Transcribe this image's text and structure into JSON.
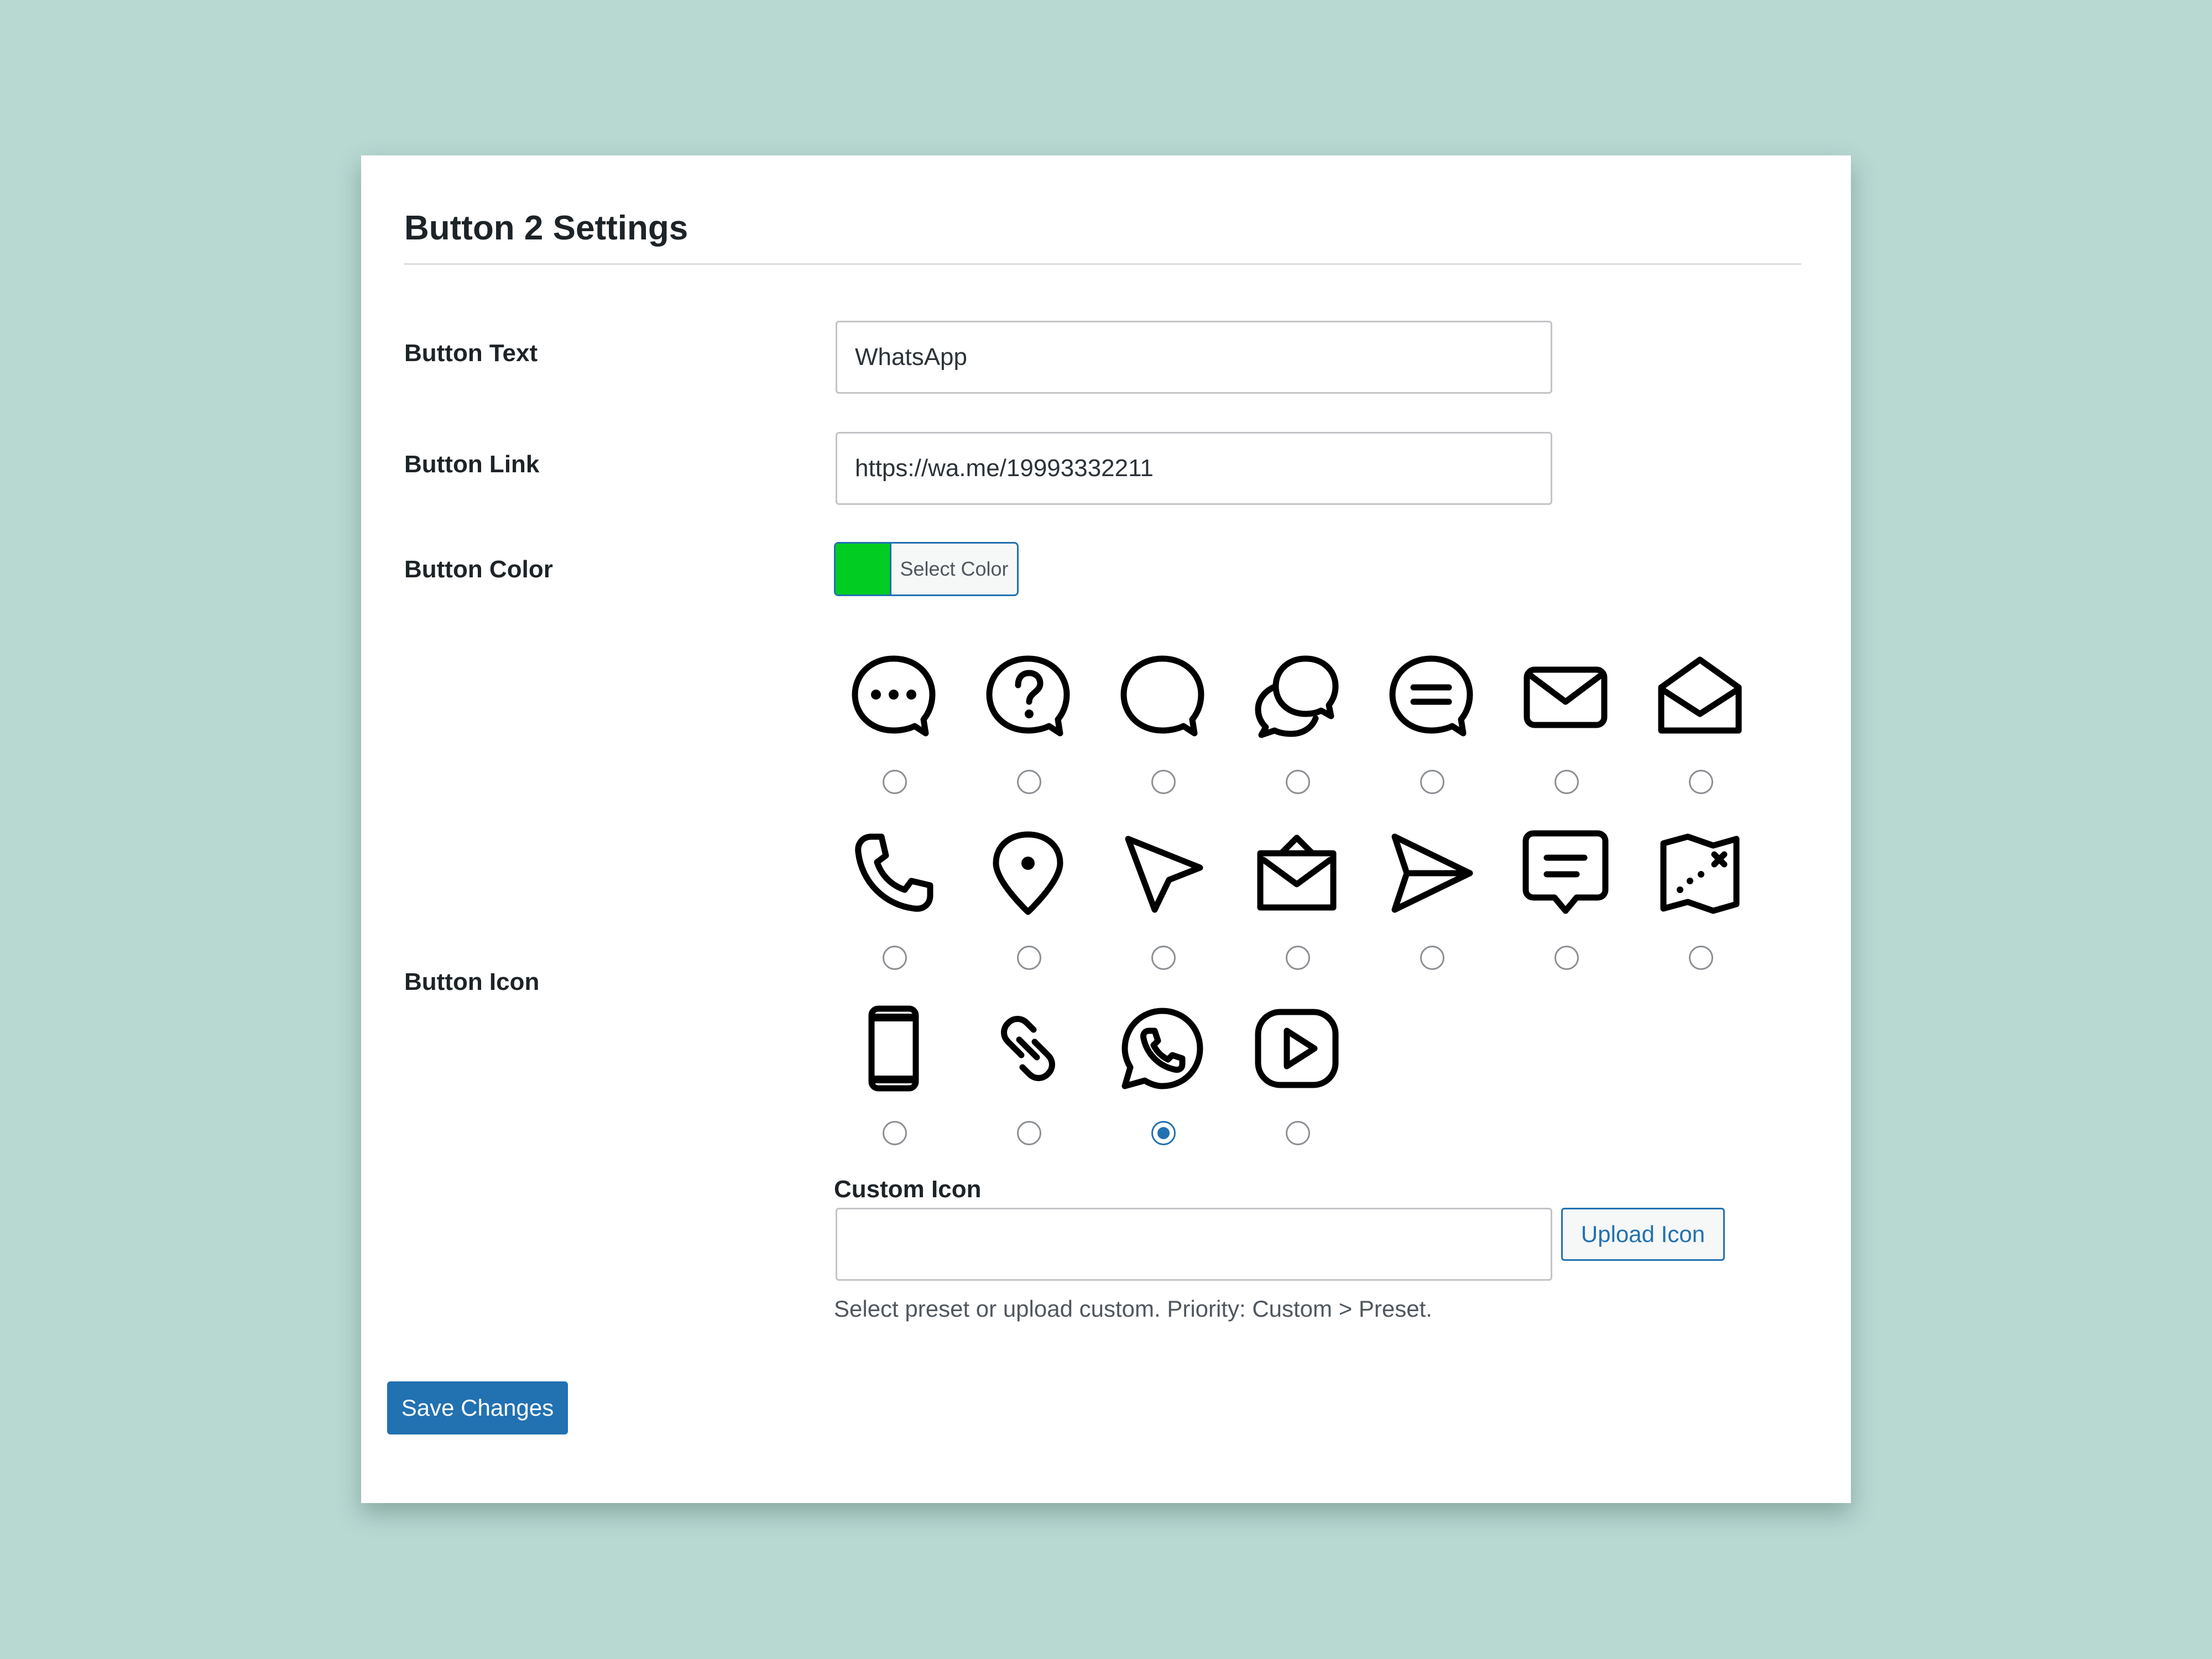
{
  "settings": {
    "title": "Button 2 Settings",
    "button_text": {
      "label": "Button Text",
      "value": "WhatsApp"
    },
    "button_link": {
      "label": "Button Link",
      "value": "https://wa.me/19993332211"
    },
    "button_color": {
      "label": "Button Color",
      "select_label": "Select Color",
      "value": "#00cc22"
    },
    "button_icon": {
      "label": "Button Icon",
      "selected": "whatsapp-icon",
      "presets": [
        "chat-dots-icon",
        "chat-question-icon",
        "chat-bubble-icon",
        "chat-double-icon",
        "chat-lines-icon",
        "mail-icon",
        "mail-open-icon",
        "phone-icon",
        "location-pin-icon",
        "cursor-pointer-icon",
        "mail-shopping-icon",
        "send-icon",
        "message-box-icon",
        "treasure-map-icon",
        "mobile-phone-icon",
        "link-icon",
        "whatsapp-icon",
        "play-icon"
      ]
    },
    "custom_icon": {
      "label": "Custom Icon",
      "value": "",
      "upload_label": "Upload Icon",
      "hint": "Select preset or upload custom. Priority: Custom > Preset."
    },
    "save_label": "Save Changes"
  }
}
